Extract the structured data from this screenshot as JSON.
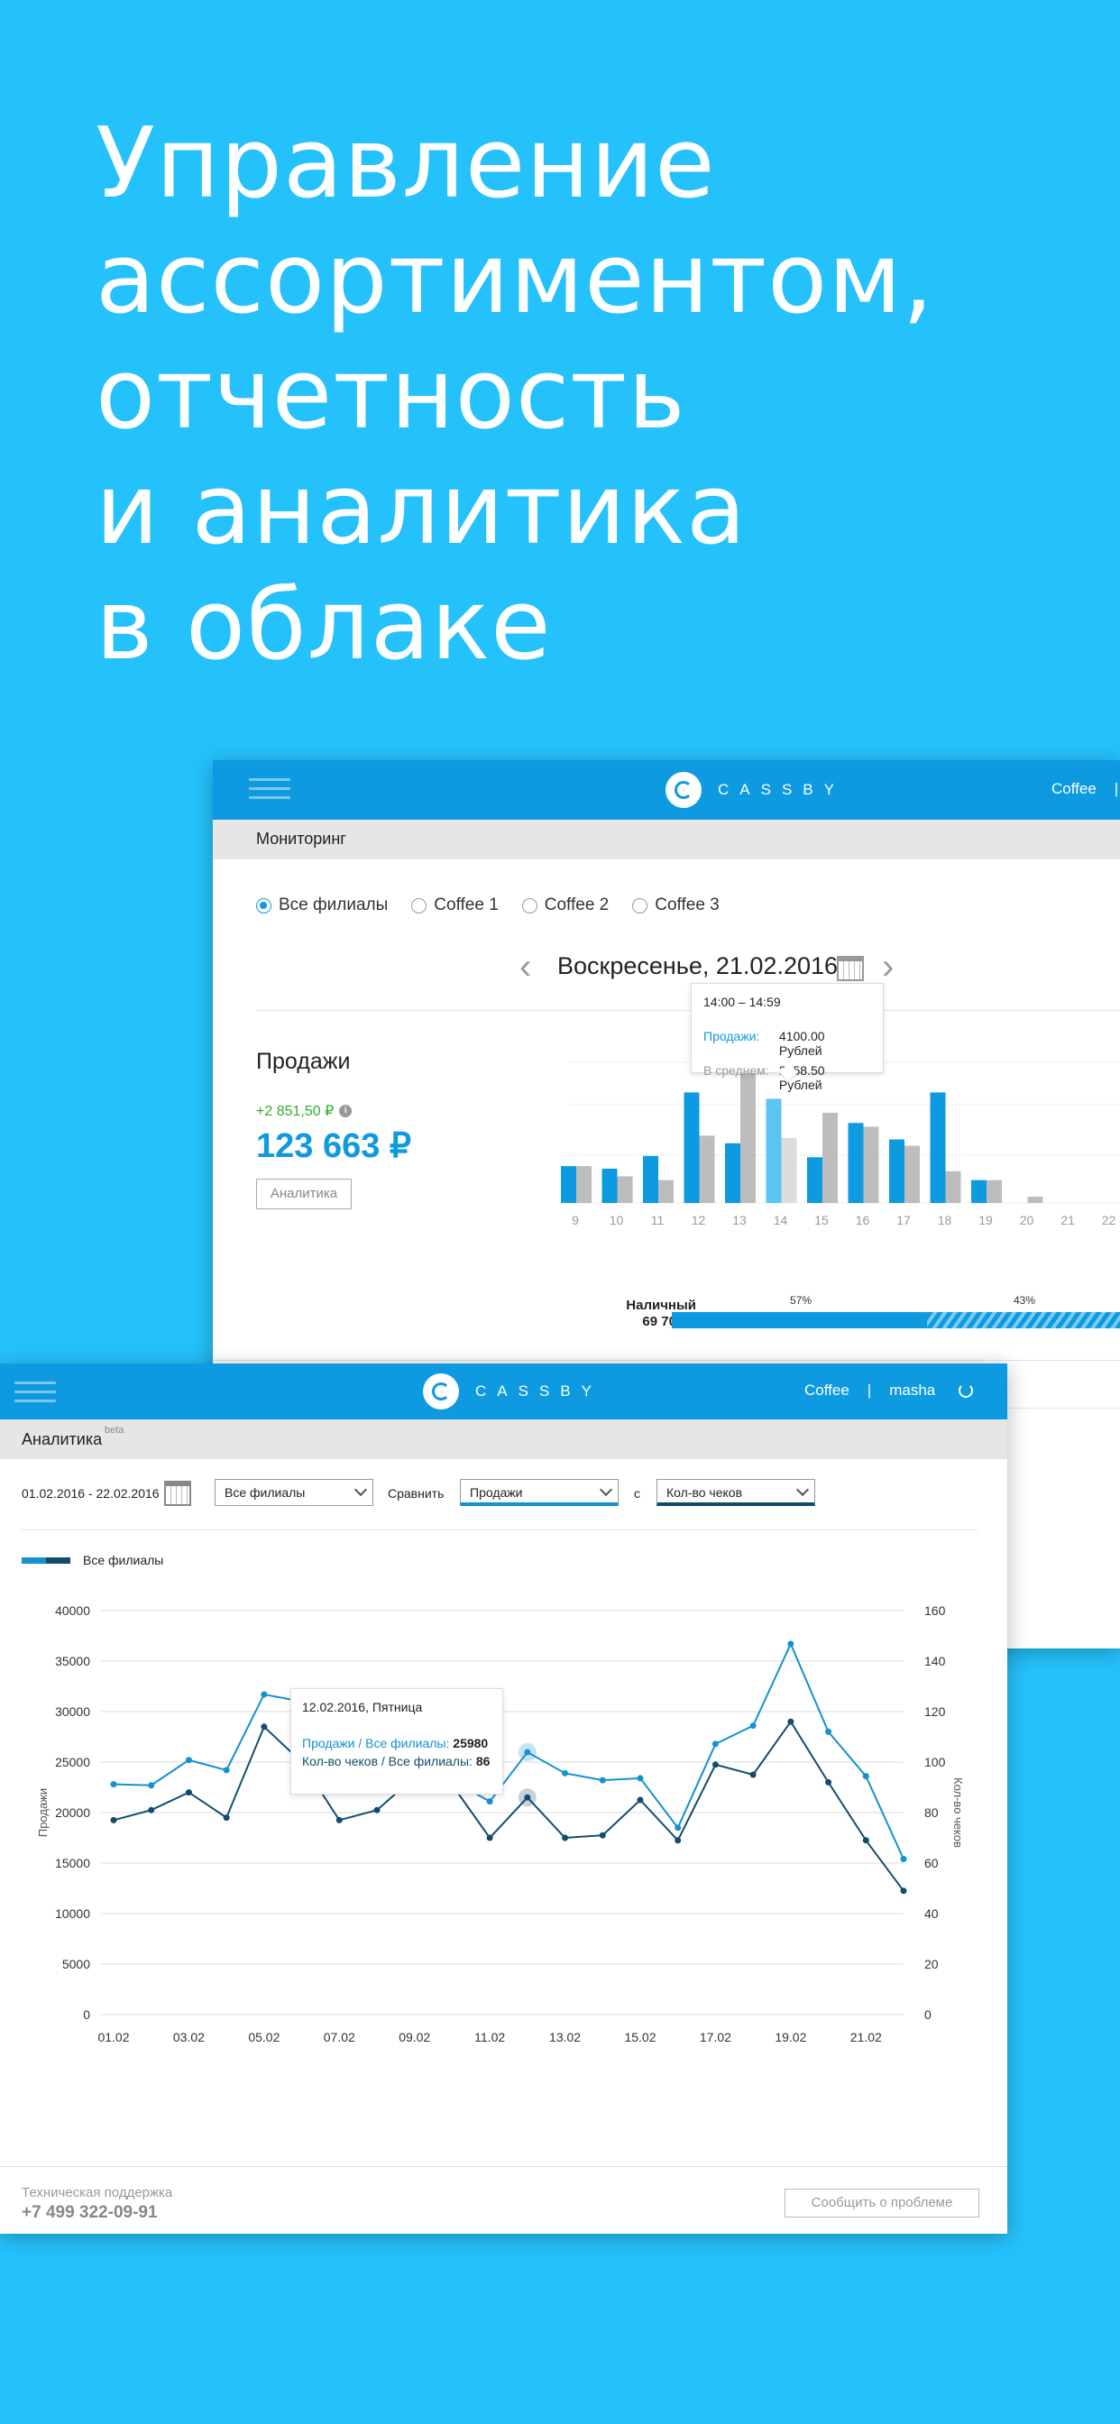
{
  "hero": {
    "lines": [
      "Управление",
      "ассортиментом,",
      "отчетность",
      "и аналитика",
      "в облаке"
    ]
  },
  "monitor": {
    "logo": "CASSBY",
    "nav": {
      "shop": "Coffee",
      "sep": "|"
    },
    "section": "Мониторинг",
    "filters": [
      "Все филиалы",
      "Coffee 1",
      "Coffee 2",
      "Coffee 3"
    ],
    "selected_filter": "Все филиалы",
    "date": "Воскресенье, 21.02.2016",
    "sales": {
      "title": "Продажи",
      "delta": "+2 851,50 ₽",
      "total": "123 663 ₽",
      "button": "Аналитика"
    },
    "tooltip": {
      "time": "14:00 – 14:59",
      "sales_label": "Продажи:",
      "sales_value": "4100.00 Рублей",
      "avg_label": "В среднем:",
      "avg_value": "2558.50 Рублей"
    },
    "cash": {
      "label": "Наличный",
      "value": "69 703 ₽",
      "pct_left": "57%",
      "pct_right": "43%"
    },
    "colors": {
      "accent": "#0d9ae0",
      "bar": "#0d9ae0",
      "bar_avg": "#bdbdbd",
      "bar_highlight": "#5cc4f3"
    }
  },
  "analytics": {
    "logo": "CASSBY",
    "nav": {
      "shop": "Coffee",
      "sep": "|",
      "user": "masha"
    },
    "section": "Аналитика",
    "beta": "beta",
    "range": "01.02.2016 - 22.02.2016",
    "branch": "Все филиалы",
    "compare_label": "Сравнить",
    "metric1": "Продажи",
    "with_label": "с",
    "metric2": "Кол-во чеков",
    "legend": "Все филиалы",
    "tooltip": {
      "date": "12.02.2016, Пятница",
      "line1_label": "Продажи / Все филиалы:",
      "line1_value": "25980",
      "line2_label": "Кол-во чеков / Все филиалы:",
      "line2_value": "86"
    },
    "footer": {
      "support": "Техническая поддержка",
      "phone": "+7 499 322-09-91",
      "report": "Сообщить о проблеме"
    },
    "colors": {
      "sales": "#1491cf",
      "checks": "#134c6b"
    }
  },
  "chart_data": [
    {
      "type": "bar",
      "categories": [
        "9",
        "10",
        "11",
        "12",
        "13",
        "14",
        "15",
        "16",
        "17",
        "18",
        "19",
        "20",
        "21",
        "22"
      ],
      "series": [
        {
          "name": "Продажи",
          "values": [
            1450,
            1350,
            1850,
            4350,
            2350,
            4100,
            1800,
            3150,
            2500,
            4350,
            900,
            0,
            0,
            0
          ]
        },
        {
          "name": "В среднем",
          "values": [
            1450,
            1050,
            900,
            2650,
            5500,
            2558.5,
            3550,
            3000,
            2250,
            1250,
            900,
            250,
            0,
            0
          ]
        }
      ],
      "highlight_category": "14"
    },
    {
      "type": "line",
      "x": [
        "01.02",
        "02.02",
        "03.02",
        "04.02",
        "05.02",
        "06.02",
        "07.02",
        "08.02",
        "09.02",
        "10.02",
        "11.02",
        "12.02",
        "13.02",
        "14.02",
        "15.02",
        "16.02",
        "17.02",
        "18.02",
        "19.02",
        "20.02",
        "21.02",
        "22.02"
      ],
      "xticks": [
        "01.02",
        "03.02",
        "05.02",
        "07.02",
        "09.02",
        "11.02",
        "13.02",
        "15.02",
        "17.02",
        "19.02",
        "21.02"
      ],
      "series": [
        {
          "name": "Продажи",
          "axis": "left",
          "values": [
            22800,
            22700,
            25200,
            24200,
            31700,
            31000,
            25800,
            24500,
            24800,
            23200,
            21100,
            25980,
            23900,
            23200,
            23400,
            18500,
            26800,
            28600,
            36700,
            28000,
            23600,
            15400
          ]
        },
        {
          "name": "Кол-во чеков",
          "axis": "right",
          "values": [
            77,
            81,
            88,
            78,
            114,
            100,
            77,
            81,
            94,
            91,
            70,
            86,
            70,
            71,
            85,
            69,
            99,
            95,
            116,
            92,
            69,
            49
          ]
        }
      ],
      "ylabel": "Продажи",
      "y2label": "Кол-во чеков",
      "ylim": [
        0,
        40000
      ],
      "y2lim": [
        0,
        160
      ],
      "yticks": [
        0,
        5000,
        10000,
        15000,
        20000,
        25000,
        30000,
        35000,
        40000
      ],
      "y2ticks": [
        0,
        20,
        40,
        60,
        80,
        100,
        120,
        140,
        160
      ],
      "grid": true,
      "highlight_x": "12.02"
    }
  ]
}
